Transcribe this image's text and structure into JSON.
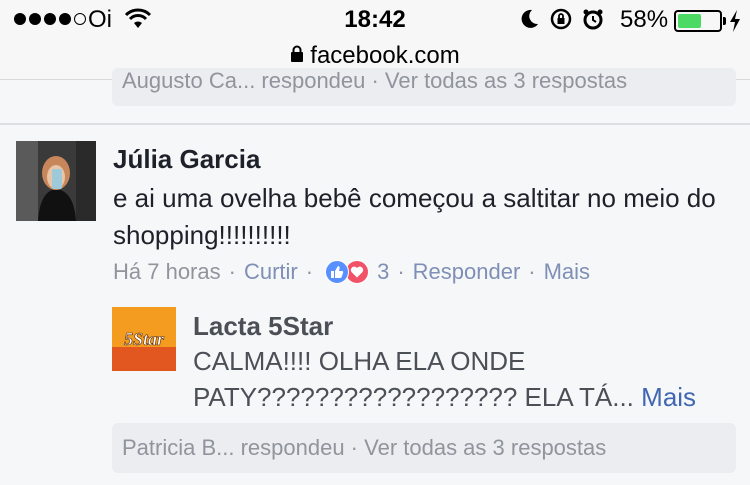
{
  "status_bar": {
    "carrier": "Oi",
    "time": "18:42",
    "battery_percent": "58%",
    "battery_level": 0.58,
    "icons": [
      "signal-dots",
      "wifi-icon",
      "moon-icon",
      "rotation-lock-icon",
      "alarm-icon",
      "battery-icon",
      "charging-bolt-icon"
    ]
  },
  "browser": {
    "url": "facebook.com",
    "lock_icon": "lock-icon"
  },
  "previous_thread": {
    "replies_text": "Augusto Ca... respondeu · Ver todas as 3 respostas"
  },
  "comment": {
    "author": "Júlia Garcia",
    "text": "e ai uma ovelha bebê começou a saltitar no meio do shopping!!!!!!!!!!",
    "time": "Há 7 horas",
    "like_label": "Curtir",
    "reaction_count": "3",
    "reply_label": "Responder",
    "more_label": "Mais",
    "reactions": [
      "like-reaction-icon",
      "love-reaction-icon"
    ]
  },
  "reply": {
    "author": "Lacta 5Star",
    "text": "CALMA!!!! OLHA ELA ONDE PATY?????????????????? ELA TÁ...",
    "more_label": "Mais",
    "avatar_logo": "5Star"
  },
  "next_thread": {
    "replies_text": "Patricia B... respondeu · Ver todas as 3 respostas"
  },
  "colors": {
    "link": "#7f8fb5",
    "meta": "#90949c",
    "like_blue": "#5890ff",
    "love_red": "#f25268",
    "battery_green": "#4cd964"
  }
}
